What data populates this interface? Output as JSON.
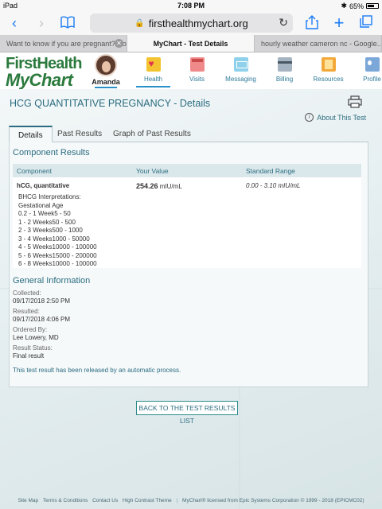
{
  "status_bar": {
    "device": "iPad",
    "time": "7:08 PM",
    "battery": "65%",
    "battery_level": 0.65
  },
  "browser": {
    "url": "firsthealthmychart.org",
    "tabs": [
      {
        "label": "Want to know if you are pregnant? No...",
        "active": false
      },
      {
        "label": "MyChart - Test Details",
        "active": true
      },
      {
        "label": "hourly weather cameron nc - Google...",
        "active": false
      }
    ]
  },
  "header": {
    "logo_line1": "FirstHealth",
    "logo_line2": "MyChart",
    "user_name": "Amanda",
    "nav": [
      {
        "label": "Health",
        "icon": "heart-icon",
        "active": true
      },
      {
        "label": "Visits",
        "icon": "calendar-icon",
        "active": false
      },
      {
        "label": "Messaging",
        "icon": "envelope-icon",
        "active": false
      },
      {
        "label": "Billing",
        "icon": "credit-card-icon",
        "active": false
      },
      {
        "label": "Resources",
        "icon": "book-icon",
        "active": false
      },
      {
        "label": "Profile",
        "icon": "id-card-icon",
        "active": false
      }
    ]
  },
  "page": {
    "title": "HCG QUANTITATIVE PREGNANCY - Details",
    "about_link": "About This Test",
    "tabs": [
      "Details",
      "Past Results",
      "Graph of Past Results"
    ],
    "active_tab": "Details",
    "component_results": {
      "heading": "Component Results",
      "columns": [
        "Component",
        "Your Value",
        "Standard Range"
      ],
      "component": "hCG, quantitative",
      "value": "254.26",
      "unit": "mIU/mL",
      "range": "0.00 - 3.10 mIU/mL",
      "interpretation": [
        "BHCG Interpretations:",
        "Gestational Age",
        "0.2 - 1 Week5 - 50",
        "1 - 2 Weeks50 - 500",
        "2 - 3 Weeks500 - 1000",
        "3 - 4 Weeks1000 - 50000",
        "4 - 5 Weeks10000 - 100000",
        "5 - 6 Weeks15000 - 200000",
        "6 - 8 Weeks10000 - 100000"
      ]
    },
    "general_info": {
      "heading": "General Information",
      "collected_label": "Collected:",
      "collected": "09/17/2018 2:50 PM",
      "resulted_label": "Resulted:",
      "resulted": "09/17/2018 4:06 PM",
      "ordered_label": "Ordered By:",
      "ordered": "Lee Lowery, MD",
      "status_label": "Result Status:",
      "status": "Final result",
      "released_note": "This test result has been released by an automatic process."
    },
    "back_button": "BACK TO THE TEST RESULTS LIST"
  },
  "footer": {
    "links": [
      "Site Map",
      "Terms & Conditions",
      "Contact Us",
      "High Contrast Theme"
    ],
    "license": "MyChart® licensed from Epic Systems Corporation © 1999 - 2018 (EPICMC02)"
  }
}
